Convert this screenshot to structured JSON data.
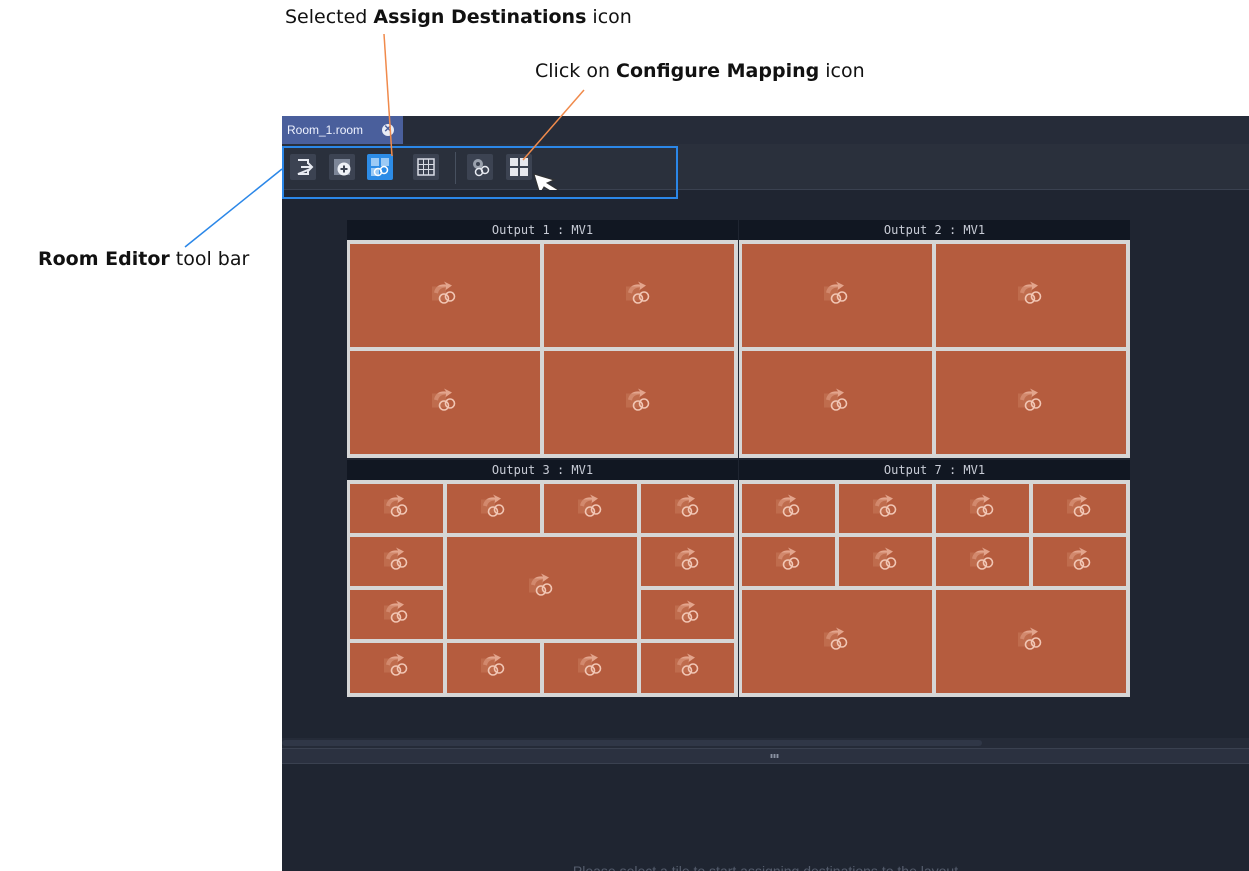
{
  "annotations": {
    "assign_prefix": "Selected ",
    "assign_bold": "Assign Destinations",
    "assign_suffix": " icon",
    "config_prefix": "Click on ",
    "config_bold": "Configure Mapping",
    "config_suffix": " icon",
    "toolbar_bold": "Room Editor",
    "toolbar_suffix": " tool bar"
  },
  "tab": {
    "label": "Room_1.room",
    "close_icon": "close-icon"
  },
  "toolbar": {
    "buttons": [
      {
        "name": "exit-editor-icon"
      },
      {
        "name": "add-tile-icon"
      },
      {
        "name": "assign-destinations-icon",
        "active": true
      },
      {
        "name": "grid-layout-icon"
      },
      {
        "name": "configure-settings-icon"
      },
      {
        "name": "configure-mapping-icon"
      }
    ]
  },
  "outputs": [
    {
      "title": "Output 1 : MV1"
    },
    {
      "title": "Output 2 : MV1"
    },
    {
      "title": "Output 3 : MV1"
    },
    {
      "title": "Output 7 : MV1"
    }
  ],
  "bottom": {
    "hint": "Please select a tile to start assigning destinations to the layout"
  },
  "colors": {
    "tile": "#b55c3e",
    "accent": "#2b87e8",
    "leader": "#f08a4b"
  }
}
